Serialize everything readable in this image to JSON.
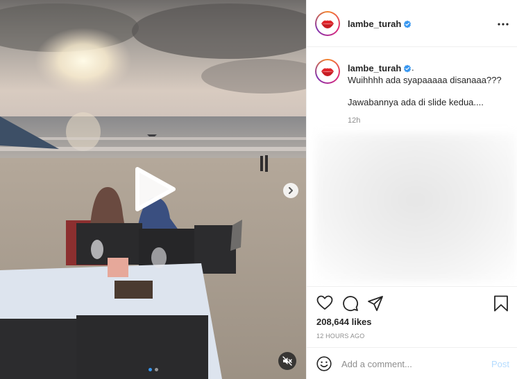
{
  "post": {
    "username": "lambe_turah",
    "verified": true,
    "caption_dot": ".",
    "caption_lines": [
      "Wuihhhh ada syapaaaaa disanaaa???",
      "Jawabannya ada di slide kedua...."
    ],
    "caption_time": "12h",
    "likes": "208,644 likes",
    "posted_ago": "12 HOURS AGO"
  },
  "comment": {
    "placeholder": "Add a comment...",
    "post_label": "Post"
  },
  "media": {
    "slides": 2,
    "active_slide": 1,
    "type": "video",
    "muted": true
  },
  "icons": {
    "like": "heart-icon",
    "comment": "comment-icon",
    "share": "share-icon",
    "save": "bookmark-icon",
    "more": "more-options-icon",
    "emoji": "emoji-icon",
    "play": "play-icon",
    "next": "chevron-right-icon",
    "mute": "speaker-muted-icon"
  },
  "colors": {
    "verified": "#3897f0",
    "post_disabled": "#b3dbff",
    "muted_text": "#8e8e8e"
  }
}
